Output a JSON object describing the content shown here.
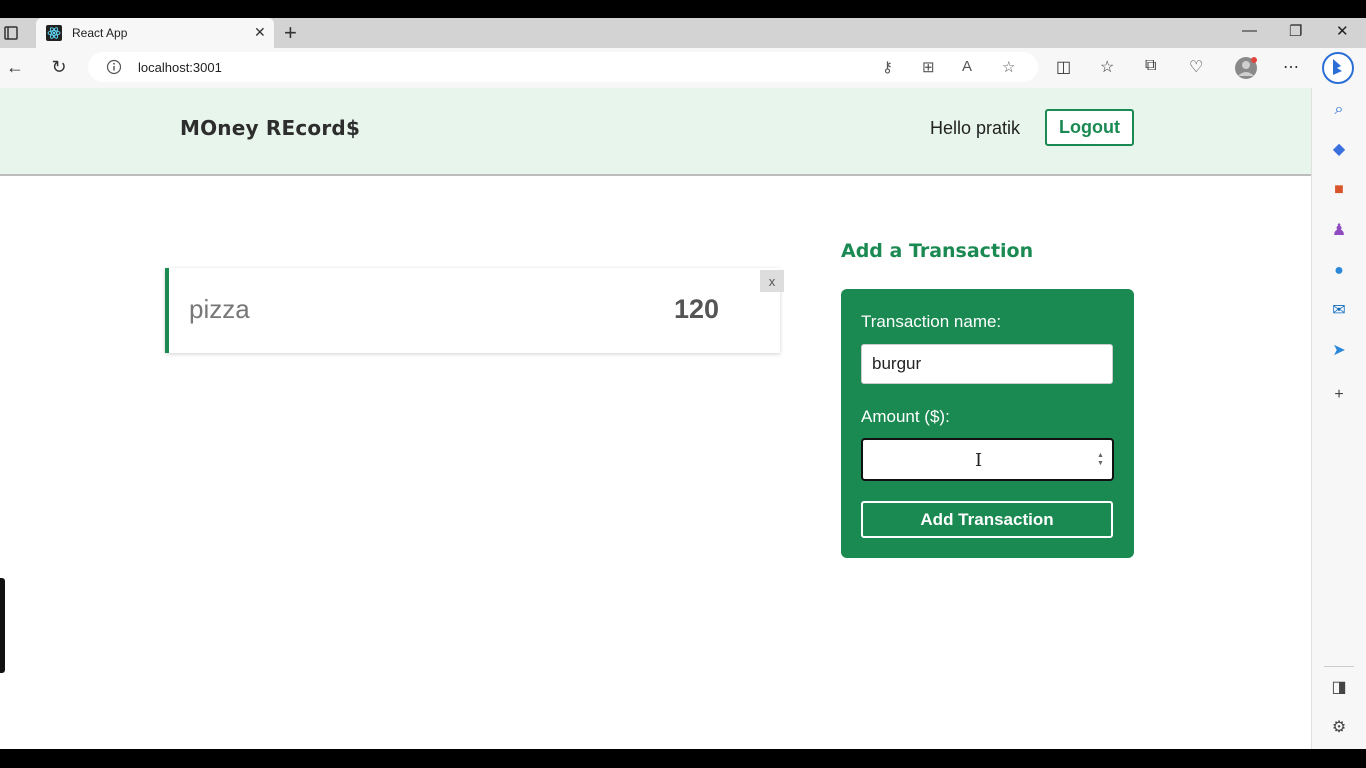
{
  "browser": {
    "tab_title": "React App",
    "url": "localhost:3001"
  },
  "header": {
    "brand": "MOney REcord$",
    "greeting": "Hello pratik",
    "logout_label": "Logout"
  },
  "transactions": [
    {
      "name": "pizza",
      "amount": "120",
      "delete_label": "x"
    }
  ],
  "form": {
    "title": "Add a Transaction",
    "name_label": "Transaction name:",
    "name_value": "burgur",
    "amount_label": "Amount ($):",
    "amount_value": "",
    "submit_label": "Add Transaction"
  },
  "colors": {
    "accent": "#1a8a52",
    "header_bg": "#e8f5ec"
  }
}
